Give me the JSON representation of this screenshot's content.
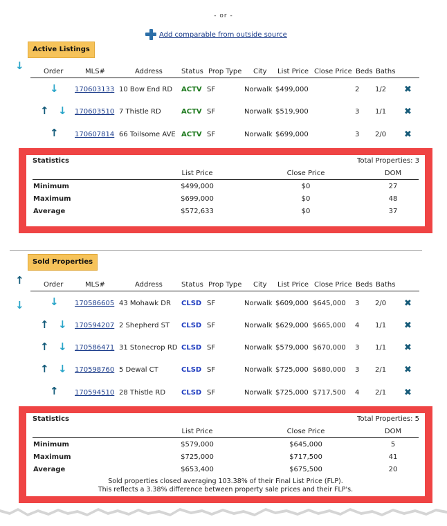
{
  "header": {
    "or_text": "- or -",
    "add_link_label": "Add comparable from outside source"
  },
  "columns": {
    "order": "Order",
    "mls": "MLS#",
    "address": "Address",
    "status": "Status",
    "prop_type": "Prop Type",
    "city": "City",
    "list_price": "List Price",
    "close_price": "Close Price",
    "beds": "Beds",
    "baths": "Baths"
  },
  "active": {
    "title": "Active Listings",
    "rows": [
      {
        "mls": "170603133",
        "address": "10 Bow End RD",
        "status": "ACTV",
        "type": "SF",
        "city": "Norwalk",
        "list": "$499,000",
        "close": "",
        "beds": "2",
        "baths": "1/2"
      },
      {
        "mls": "170603510",
        "address": "7 Thistle RD",
        "status": "ACTV",
        "type": "SF",
        "city": "Norwalk",
        "list": "$519,900",
        "close": "",
        "beds": "3",
        "baths": "1/1"
      },
      {
        "mls": "170607814",
        "address": "66 Toilsome AVE",
        "status": "ACTV",
        "type": "SF",
        "city": "Norwalk",
        "list": "$699,000",
        "close": "",
        "beds": "3",
        "baths": "2/0"
      }
    ],
    "stats": {
      "title": "Statistics",
      "total": "Total Properties: 3",
      "col_list": "List Price",
      "col_close": "Close Price",
      "col_dom": "DOM",
      "rows": [
        {
          "label": "Minimum",
          "list": "$499,000",
          "close": "$0",
          "dom": "27"
        },
        {
          "label": "Maximum",
          "list": "$699,000",
          "close": "$0",
          "dom": "48"
        },
        {
          "label": "Average",
          "list": "$572,633",
          "close": "$0",
          "dom": "37"
        }
      ]
    }
  },
  "sold": {
    "title": "Sold Properties",
    "rows": [
      {
        "mls": "170586605",
        "address": "43 Mohawk DR",
        "status": "CLSD",
        "type": "SF",
        "city": "Norwalk",
        "list": "$609,000",
        "close": "$645,000",
        "beds": "3",
        "baths": "2/0"
      },
      {
        "mls": "170594207",
        "address": "2 Shepherd ST",
        "status": "CLSD",
        "type": "SF",
        "city": "Norwalk",
        "list": "$629,000",
        "close": "$665,000",
        "beds": "4",
        "baths": "1/1"
      },
      {
        "mls": "170586471",
        "address": "31 Stonecrop RD",
        "status": "CLSD",
        "type": "SF",
        "city": "Norwalk",
        "list": "$579,000",
        "close": "$670,000",
        "beds": "3",
        "baths": "1/1"
      },
      {
        "mls": "170598760",
        "address": "5 Dewal CT",
        "status": "CLSD",
        "type": "SF",
        "city": "Norwalk",
        "list": "$725,000",
        "close": "$680,000",
        "beds": "3",
        "baths": "2/1"
      },
      {
        "mls": "170594510",
        "address": "28 Thistle RD",
        "status": "CLSD",
        "type": "SF",
        "city": "Norwalk",
        "list": "$725,000",
        "close": "$717,500",
        "beds": "4",
        "baths": "2/1"
      }
    ],
    "stats": {
      "title": "Statistics",
      "total": "Total Properties: 5",
      "col_list": "List Price",
      "col_close": "Close Price",
      "col_dom": "DOM",
      "rows": [
        {
          "label": "Minimum",
          "list": "$579,000",
          "close": "$645,000",
          "dom": "5"
        },
        {
          "label": "Maximum",
          "list": "$725,000",
          "close": "$717,500",
          "dom": "41"
        },
        {
          "label": "Average",
          "list": "$653,400",
          "close": "$675,500",
          "dom": "20"
        }
      ],
      "note_line1": "Sold properties closed averaging 103.38% of their Final List Price (FLP).",
      "note_line2": "This reflects a 3.38% difference between property sale prices and their FLP's."
    }
  },
  "icons": {
    "up": "up-arrow-icon",
    "down": "down-arrow-icon",
    "delete": "delete-x-icon",
    "add": "plus-icon"
  },
  "colors": {
    "badge": "#f6c35a",
    "stats_border": "#ef4444",
    "actv": "#1e7a1e",
    "clsd": "#1d3bbf",
    "link": "#1a3b8a"
  }
}
